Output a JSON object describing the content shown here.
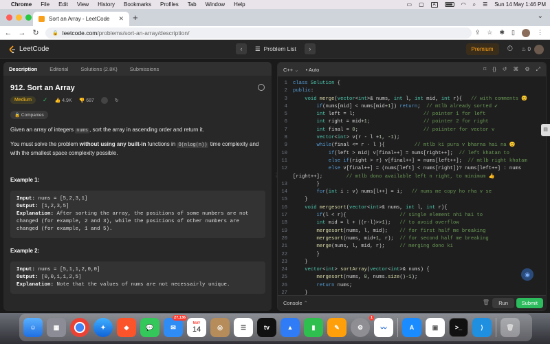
{
  "menubar": {
    "app": "Chrome",
    "items": [
      "File",
      "Edit",
      "View",
      "History",
      "Bookmarks",
      "Profiles",
      "Tab",
      "Window",
      "Help"
    ],
    "input_indicator": "A",
    "datetime": "Sun 14 May  1:46 PM"
  },
  "browser": {
    "tab_title": "Sort an Array - LeetCode",
    "url_host": "leetcode.com",
    "url_path": "/problems/sort-an-array/description/"
  },
  "lcnav": {
    "logo": "LeetCode",
    "problem_list": "Problem List",
    "premium": "Premium",
    "streak": "0"
  },
  "left": {
    "tabs": [
      "Description",
      "Editorial",
      "Solutions (2.8K)",
      "Submissions"
    ],
    "title": "912. Sort an Array",
    "difficulty": "Medium",
    "likes": "4.9K",
    "dislikes": "687",
    "companies": "Companies",
    "desc_1a": "Given an array of integers ",
    "desc_1code": "nums",
    "desc_1b": ", sort the array in ascending order and return it.",
    "desc_2a": "You must solve the problem ",
    "desc_2bold": "without using any built-in",
    "desc_2b": " functions in ",
    "desc_2code": "O(nlog(n))",
    "desc_2c": " time complexity and with the smallest space complexity possible.",
    "examples": [
      {
        "heading": "Example 1:",
        "input_label": "Input:",
        "input": " nums = [5,2,3,1]",
        "output_label": "Output:",
        "output": " [1,2,3,5]",
        "explanation_label": "Explanation:",
        "explanation": " After sorting the array, the positions of some numbers are not changed (for example, 2 and 3), while the positions of other numbers are changed (for example, 1 and 5)."
      },
      {
        "heading": "Example 2:",
        "input_label": "Input:",
        "input": " nums = [5,1,1,2,0,0]",
        "output_label": "Output:",
        "output": " [0,0,1,1,2,5]",
        "explanation_label": "Explanation:",
        "explanation": " Note that the values of nums are not necessairly unique."
      }
    ]
  },
  "editor": {
    "language": "C++",
    "autosave": "Auto",
    "console": "Console",
    "run": "Run",
    "submit": "Submit",
    "code_lines": [
      "class Solution {",
      "public:",
      "    void merge(vector<int>& nums, int l, int mid, int r){   // with comments 😊",
      "        if(nums[mid] < nums[mid+1]) return;  // mtlb already sorted ✔",
      "        int left = l;                       // pointer 1 for left",
      "        int right = mid+1;                  // pointer 2 for right",
      "        int final = 0;                      // poiinter for vector v",
      "        vector<int> v(r - l +1, -1);",
      "        while(final <= r - l ){          // mtlb ki pura v bharna hai na 😊",
      "            if(left > mid) v[final++] = nums[right++];  // left khatam to",
      "            else if(right > r) v[final++] = nums[left++];  // mtlb right khatam",
      "            else v[final++] = (nums[left] < nums[right])? nums[left++] : nums",
      "[right++];        // mtlb dono available left n right, to minimum 👍",
      "        }",
      "        for(int i : v) nums[l++] = i;   // nums me copy ho rha v se",
      "    }",
      "    void mergesort(vector<int>& nums, int l, int r){",
      "        if(l < r){                  // single element nhi hai to",
      "        int mid = l + ((r-l)>>1);   // to avoid overflow",
      "        mergesort(nums, l, mid);    // for first half me breaking",
      "        mergesort(nums, mid+1, r);  // for second half me breaking",
      "        merge(nums, l, mid, r);     // merging dono ki",
      "        }",
      "    }",
      "    vector<int> sortArray(vector<int>& nums) {",
      "        mergesort(nums, 0, nums.size()-1);",
      "        return nums;",
      "    }"
    ],
    "line_numbers": [
      "1",
      "2",
      "3",
      "4",
      "5",
      "6",
      "7",
      "8",
      "9",
      "10",
      "11",
      "12",
      "",
      "13",
      "14",
      "15",
      "16",
      "17",
      "18",
      "19",
      "20",
      "21",
      "22",
      "23",
      "24",
      "25",
      "26",
      "27"
    ]
  },
  "dock": {
    "mail_badge": "27,136",
    "settings_badge": "1",
    "calendar_month": "MAY",
    "calendar_day": "14"
  },
  "colors": {
    "accent_orange": "#ffa116",
    "submit_green": "#2cbb5d",
    "difficulty_medium": "#ffc01e"
  }
}
